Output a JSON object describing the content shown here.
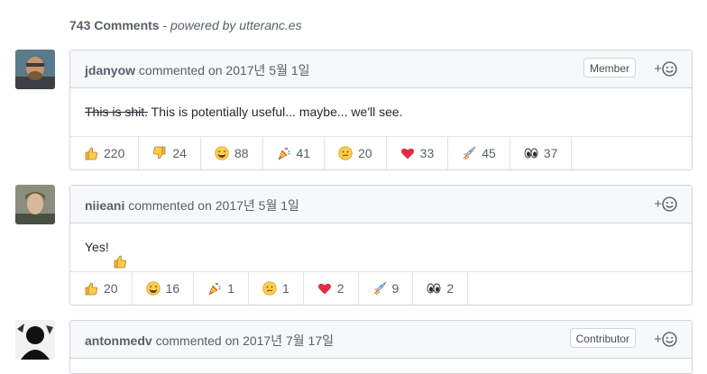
{
  "header": {
    "count": "743 Comments",
    "powered": "- powered by utteranc.es"
  },
  "comments": [
    {
      "login": "jdanyow",
      "action": "commented on 2017년 5월 1일",
      "badge": "Member",
      "add_reaction": "+",
      "body_strike": "This is shit.",
      "body_text": " This is potentially useful... maybe... we'll see.",
      "reactions": [
        {
          "icon": "thumbs-up-icon",
          "count": "220"
        },
        {
          "icon": "thumbs-down-icon",
          "count": "24"
        },
        {
          "icon": "laugh-icon",
          "count": "88"
        },
        {
          "icon": "hooray-icon",
          "count": "41"
        },
        {
          "icon": "confused-icon",
          "count": "20"
        },
        {
          "icon": "heart-icon",
          "count": "33"
        },
        {
          "icon": "rocket-icon",
          "count": "45"
        },
        {
          "icon": "eyes-icon",
          "count": "37"
        }
      ]
    },
    {
      "login": "niieani",
      "action": "commented on 2017년 5월 1일",
      "badge": "",
      "add_reaction": "+",
      "body_text": "Yes! ",
      "reactions": [
        {
          "icon": "thumbs-up-icon",
          "count": "20"
        },
        {
          "icon": "laugh-icon",
          "count": "16"
        },
        {
          "icon": "hooray-icon",
          "count": "1"
        },
        {
          "icon": "confused-icon",
          "count": "1"
        },
        {
          "icon": "heart-icon",
          "count": "2"
        },
        {
          "icon": "rocket-icon",
          "count": "9"
        },
        {
          "icon": "eyes-icon",
          "count": "2"
        }
      ]
    },
    {
      "login": "antonmedv",
      "action": "commented on 2017년 7월 17일",
      "badge": "Contributor",
      "add_reaction": "+"
    }
  ],
  "colors": {
    "header_bg": "#f6f8fa",
    "border": "#d1d5da",
    "muted_text": "#586069"
  }
}
